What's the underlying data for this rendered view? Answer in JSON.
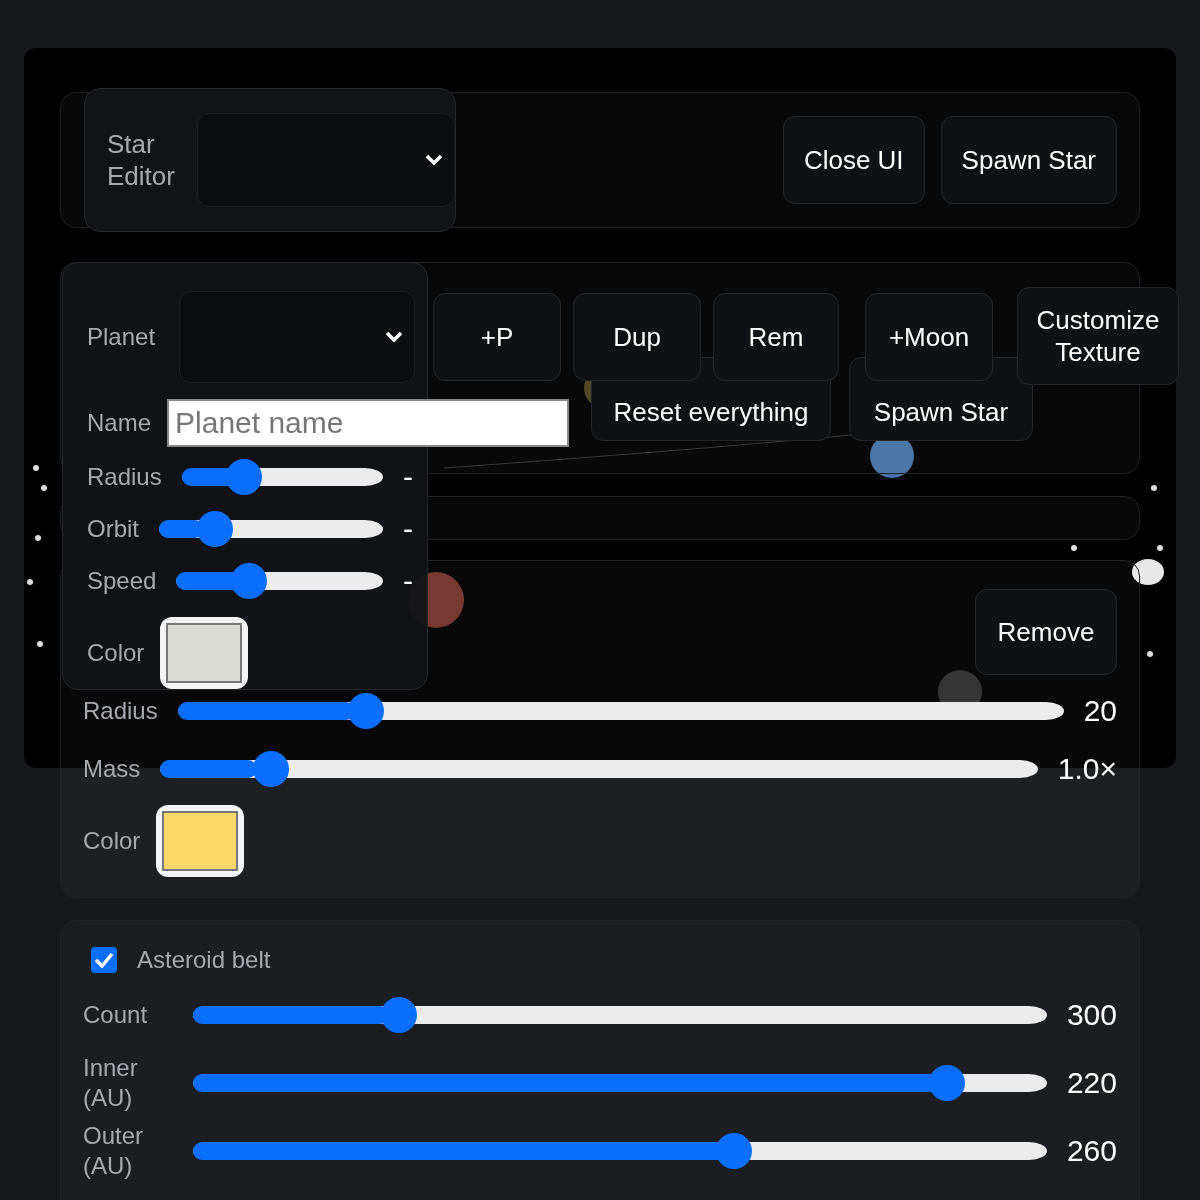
{
  "star_editor": {
    "label": "Star Editor"
  },
  "top_buttons": [
    "Close UI",
    "Spawn Star"
  ],
  "toolbar": {
    "buttons": [
      "+P",
      "Dup",
      "Rem",
      "+Moon",
      "Customize Texture"
    ],
    "actions": [
      "Reset everything",
      "Spawn Star"
    ]
  },
  "planet_panel": {
    "select_label": "Planet",
    "name_label": "Name",
    "name_placeholder": "Planet name",
    "sliders": [
      {
        "label": "Radius",
        "level": 0.27,
        "reading": "-"
      },
      {
        "label": "Orbit",
        "level": 0.2,
        "reading": "-"
      },
      {
        "label": "Speed",
        "level": 0.32,
        "reading": "-"
      }
    ],
    "color_label": "Color",
    "color": "#dcdcd6"
  },
  "star_panel": {
    "remove": "Remove",
    "sliders": [
      {
        "label": "Radius",
        "level": 0.2,
        "reading": "20"
      },
      {
        "label": "Mass",
        "level": 0.11,
        "reading": "1.0×"
      }
    ],
    "color_label": "Color",
    "color": "#fcd96a"
  },
  "asteroid_belt": {
    "label": "Asteroid belt",
    "checked": true,
    "sliders": [
      {
        "label": "Count",
        "level": 0.23,
        "reading": "300"
      },
      {
        "label": "Inner (AU)",
        "level": 0.9,
        "reading": "220"
      },
      {
        "label": "Outer (AU)",
        "level": 0.64,
        "reading": "260"
      }
    ]
  }
}
